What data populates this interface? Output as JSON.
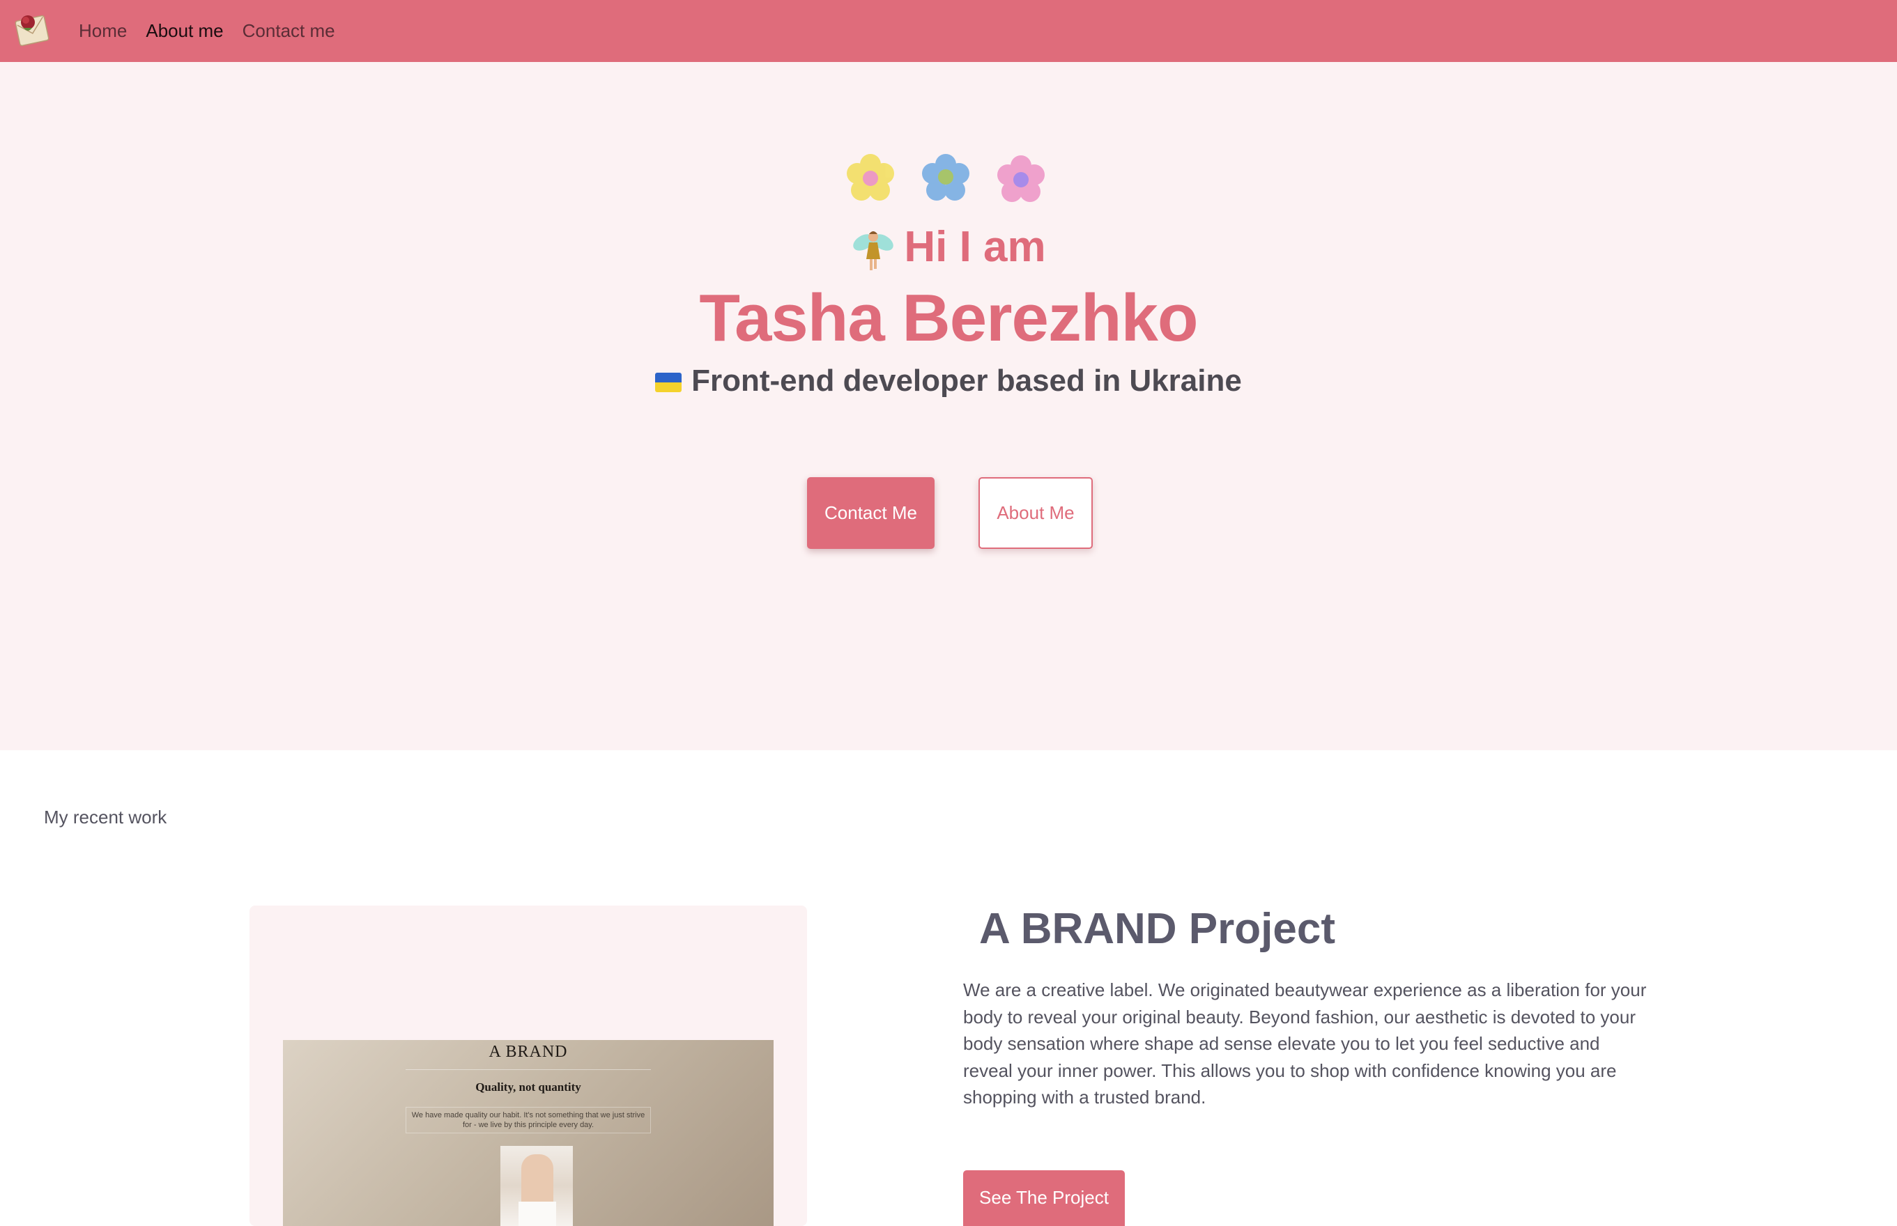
{
  "nav": {
    "logo_icon": "envelope-with-rose-logo",
    "items": [
      {
        "label": "Home",
        "active": false
      },
      {
        "label": "About me",
        "active": true
      },
      {
        "label": "Contact me",
        "active": false
      }
    ],
    "background": "#df6c7b"
  },
  "hero": {
    "decoration_icons": [
      "yellow-flower-icon",
      "blue-flower-icon",
      "pink-flower-icon",
      "fairy-emoji-icon",
      "ukraine-flag-emoji-icon"
    ],
    "greeting": "Hi I am",
    "name": "Tasha Berezhko",
    "role": "Front-end developer based in Ukraine",
    "primary_button": "Contact Me",
    "secondary_button": "About Me",
    "background": "#fcf2f3",
    "accent": "#df6c7b"
  },
  "work": {
    "section_label": "My recent work",
    "project": {
      "title": "A BRAND Project",
      "description": "We are a creative label. We originated beautywear experience as a liberation for your body to reveal your original beauty. Beyond fashion, our aesthetic is devoted to your body sensation where shape ad sense elevate you to let you feel seductive and reveal your inner power. This allows you to shop with confidence knowing you are shopping with a trusted brand.",
      "button": "See The Project",
      "preview": {
        "brand": "A BRAND",
        "tagline": "Quality, not quantity",
        "blurb": "We have made quality our habit. It's not something that we just strive for - we live by this principle every day."
      }
    }
  }
}
